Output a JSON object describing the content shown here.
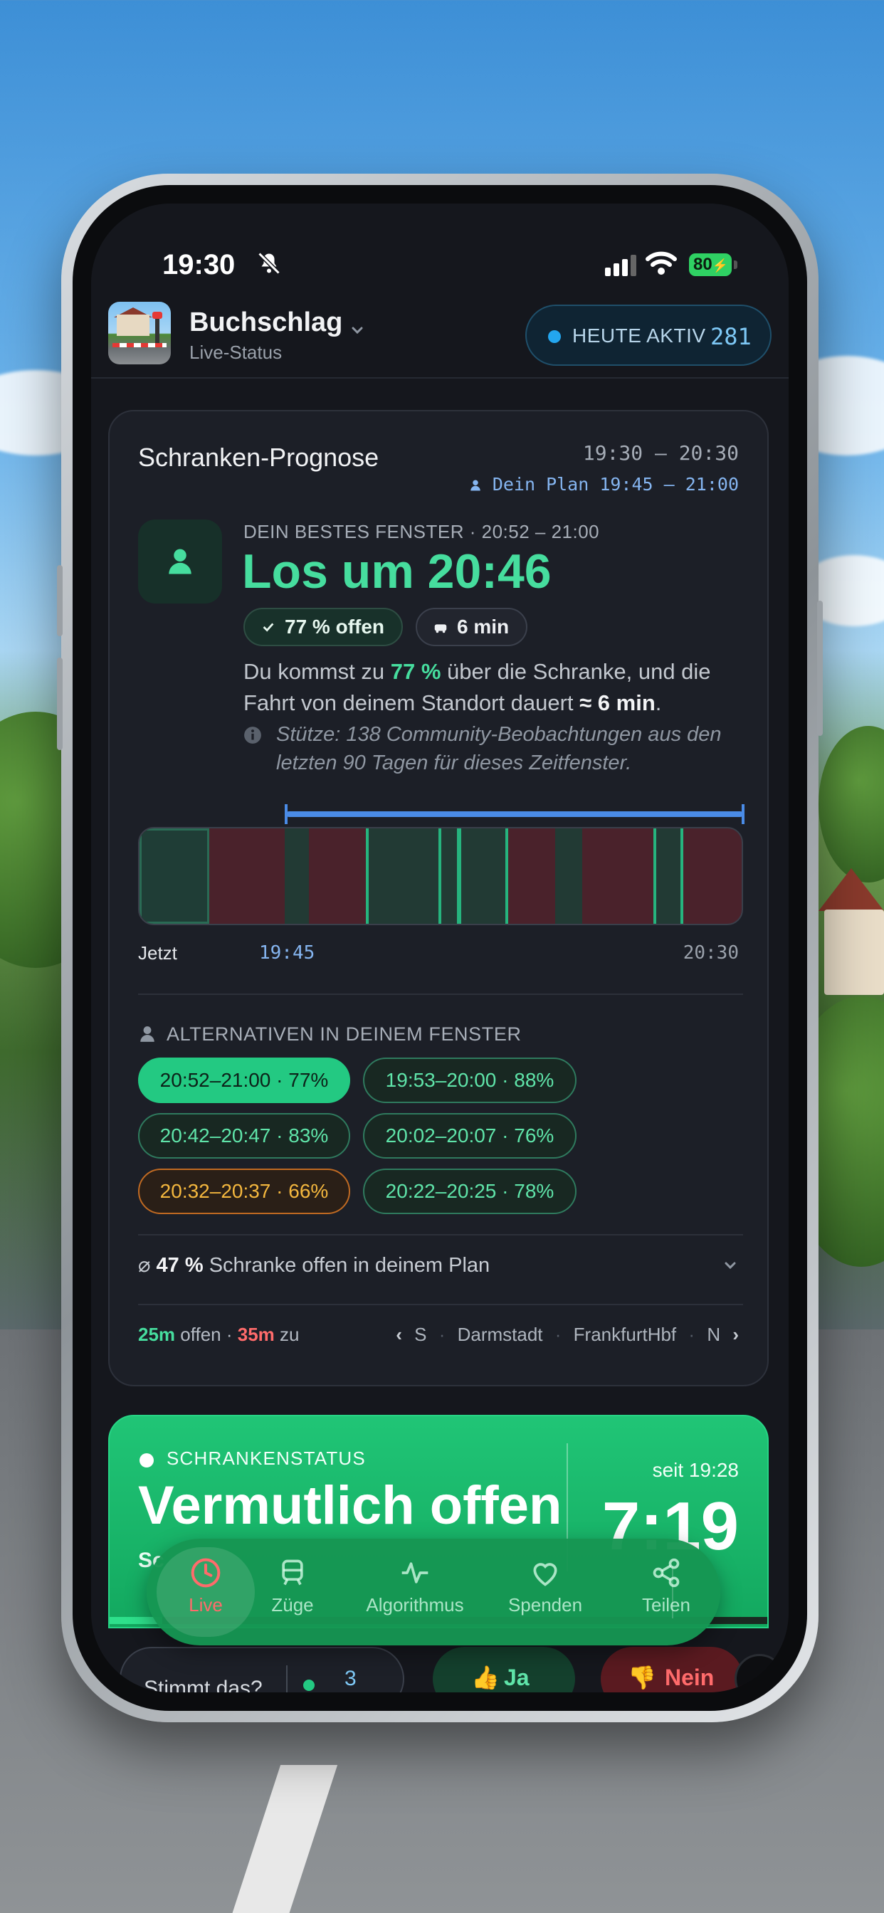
{
  "status_bar": {
    "time": "19:30",
    "battery": "80"
  },
  "header": {
    "app_name": "Buchschlag",
    "subtitle": "Live-Status",
    "active_label": "HEUTE AKTIV",
    "active_count": "281"
  },
  "prognose": {
    "title": "Schranken-Prognose",
    "range": "19:30 – 20:30",
    "plan": "Dein Plan 19:45 – 21:00",
    "best_label": "DEIN BESTES FENSTER · 20:52 – 21:00",
    "headline": "Los um 20:46",
    "chip_open": "77 % offen",
    "chip_drive": "6 min",
    "desc_a": "Du kommst zu ",
    "desc_pct": "77 %",
    "desc_b": " über die Schranke, und die Fahrt von deinem Standort dauert ",
    "desc_time": "≈ 6 min",
    "desc_c": ".",
    "note": "Stütze: 138 Community-Beobachtungen aus den letzten 90 Tagen für dieses Zeitfenster.",
    "timeline_start": "Jetzt",
    "timeline_plan": "19:45",
    "timeline_end": "20:30",
    "alternatives_heading": "ALTERNATIVEN IN DEINEM FENSTER",
    "alternatives": [
      {
        "label": "20:52–21:00 · 77%",
        "state": "selected"
      },
      {
        "label": "19:53–20:00 · 88%",
        "state": "normal"
      },
      {
        "label": "20:42–20:47 · 83%",
        "state": "normal"
      },
      {
        "label": "20:02–20:07 · 76%",
        "state": "normal"
      },
      {
        "label": "20:32–20:37 · 66%",
        "state": "warning"
      },
      {
        "label": "20:22–20:25 · 78%",
        "state": "normal"
      }
    ],
    "avg_symbol": "⌀",
    "avg_value": "47 %",
    "avg_text": " Schranke offen in deinem Plan",
    "footer_open_value": "25m",
    "footer_open_text": " offen · ",
    "footer_closed_value": "35m",
    "footer_closed_text": " zu",
    "footer_nav": [
      "S",
      "Darmstadt",
      "FrankfurtHbf",
      "N"
    ]
  },
  "status_card": {
    "label": "SCHRANKENSTATUS",
    "headline": "Vermutlich offen",
    "since": "seit 19:28",
    "clock": "7:19",
    "sub": "Sc",
    "progress": 0.08
  },
  "feedback": {
    "question": "Stimmt das?",
    "count": "3",
    "yes": "Ja",
    "no": "Nein"
  },
  "tabs": [
    {
      "label": "Live",
      "icon": "clock-icon",
      "active": true
    },
    {
      "label": "Züge",
      "icon": "train-icon",
      "active": false
    },
    {
      "label": "Algorithmus",
      "icon": "pulse-icon",
      "active": false
    },
    {
      "label": "Spenden",
      "icon": "heart-icon",
      "active": false
    },
    {
      "label": "Teilen",
      "icon": "share-icon",
      "active": false
    }
  ],
  "colors": {
    "accent_green": "#46dd9e",
    "status_green": "#20c576",
    "closed_red": "#ff6b6b",
    "plan_blue": "#4a8be6",
    "warning_orange": "#f4b73e"
  }
}
